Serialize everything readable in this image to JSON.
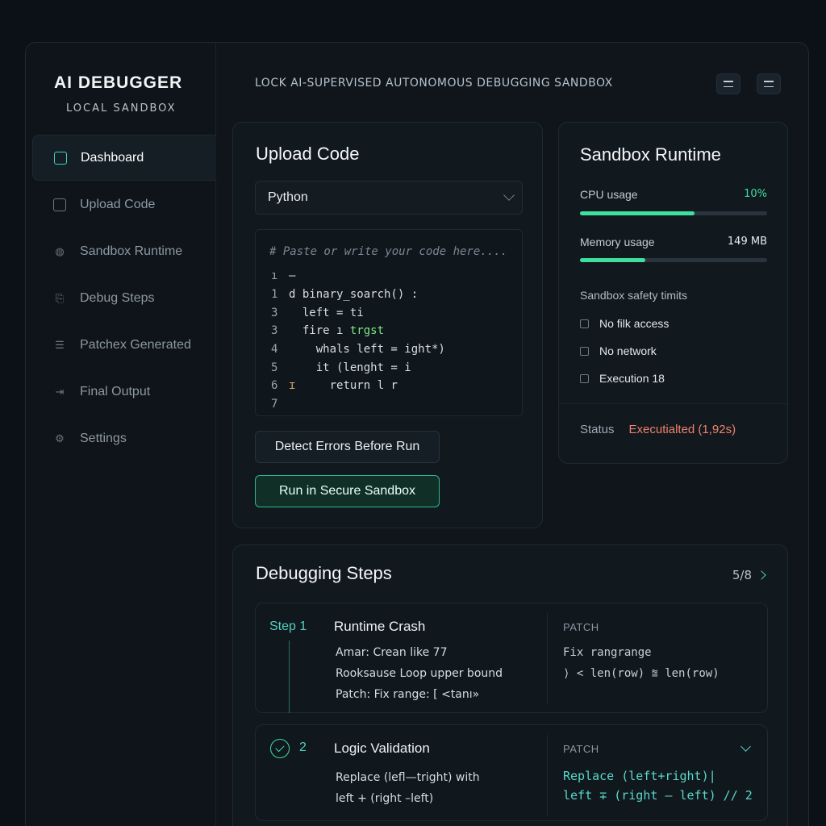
{
  "app": {
    "title": "AI DEBUGGER",
    "subtitle": "LOCAL SANDBOX",
    "header": "LOCK AI-SUPERVISED AUTONOMOUS DEBUGGING SANDBOX"
  },
  "colors": {
    "accent": "#3ad4c4",
    "success": "#3ee0a0",
    "status_warning": "#f0826b",
    "background": "#0c1117"
  },
  "sidebar": {
    "items": [
      {
        "label": "Dashboard",
        "icon": "square-icon",
        "active": true
      },
      {
        "label": "Upload Code",
        "icon": "square-icon",
        "active": false
      },
      {
        "label": "Sandbox Runtime",
        "icon": "globe-icon",
        "active": false
      },
      {
        "label": "Debug Steps",
        "icon": "clipboard-icon",
        "active": false
      },
      {
        "label": "Patchex Generated",
        "icon": "list-icon",
        "active": false
      },
      {
        "label": "Final Output",
        "icon": "export-icon",
        "active": false
      },
      {
        "label": "Settings",
        "icon": "gear-icon",
        "active": false
      }
    ]
  },
  "upload": {
    "title": "Upload Code",
    "language": "Python",
    "placeholder": "# Paste or write your code here....",
    "lines": [
      {
        "num": "ı",
        "text": "–"
      },
      {
        "num": "1",
        "text": "d binary_soarch() :"
      },
      {
        "num": "3",
        "text": "  left = ti"
      },
      {
        "num": "3",
        "text": "  fire ı ",
        "extra": "trgst"
      },
      {
        "num": "4",
        "text": "    whals left = ight*)"
      },
      {
        "num": "5",
        "text": "    it (lenght = i"
      },
      {
        "num": "6",
        "mark": "ɪ",
        "text": "     return l r"
      },
      {
        "num": "7",
        "text": ""
      }
    ],
    "detect_button": "Detect Errors Before Run",
    "run_button": "Run in Secure Sandbox"
  },
  "runtime": {
    "title": "Sandbox Runtime",
    "cpu_label": "CPU usage",
    "cpu_value": "10%",
    "cpu_fill": 0.61,
    "memory_label": "Memory usage",
    "memory_value": "149 MB",
    "memory_fill": 0.35,
    "limits_title": "Sandbox safety timits",
    "limits": [
      "No filk access",
      "No network",
      "Execution 18"
    ],
    "status_label": "Status",
    "status_value": "Executialted (1,92s)"
  },
  "debug": {
    "title": "Debugging Steps",
    "count": "5/8",
    "steps": [
      {
        "label": "Step 1",
        "title": "Runtime Crash",
        "details": [
          "Amar: Crean like 77",
          "Rooksause Loop upper bound",
          "Patch: Fix range: [ <tanı»"
        ],
        "patch_label": "PATCH",
        "patch_lines": [
          "Fix rangrange",
          "⟩ < len(row) ⩰ len(row)"
        ]
      },
      {
        "label": "2",
        "title": "Logic Validation",
        "details": [
          "Replace (lefl—tright) with",
          "left + (right –left)"
        ],
        "patch_label": "PATCH",
        "patch_lines": [
          "Replace (left+right)|",
          "left ∓ (right – left) // 2"
        ]
      }
    ]
  }
}
